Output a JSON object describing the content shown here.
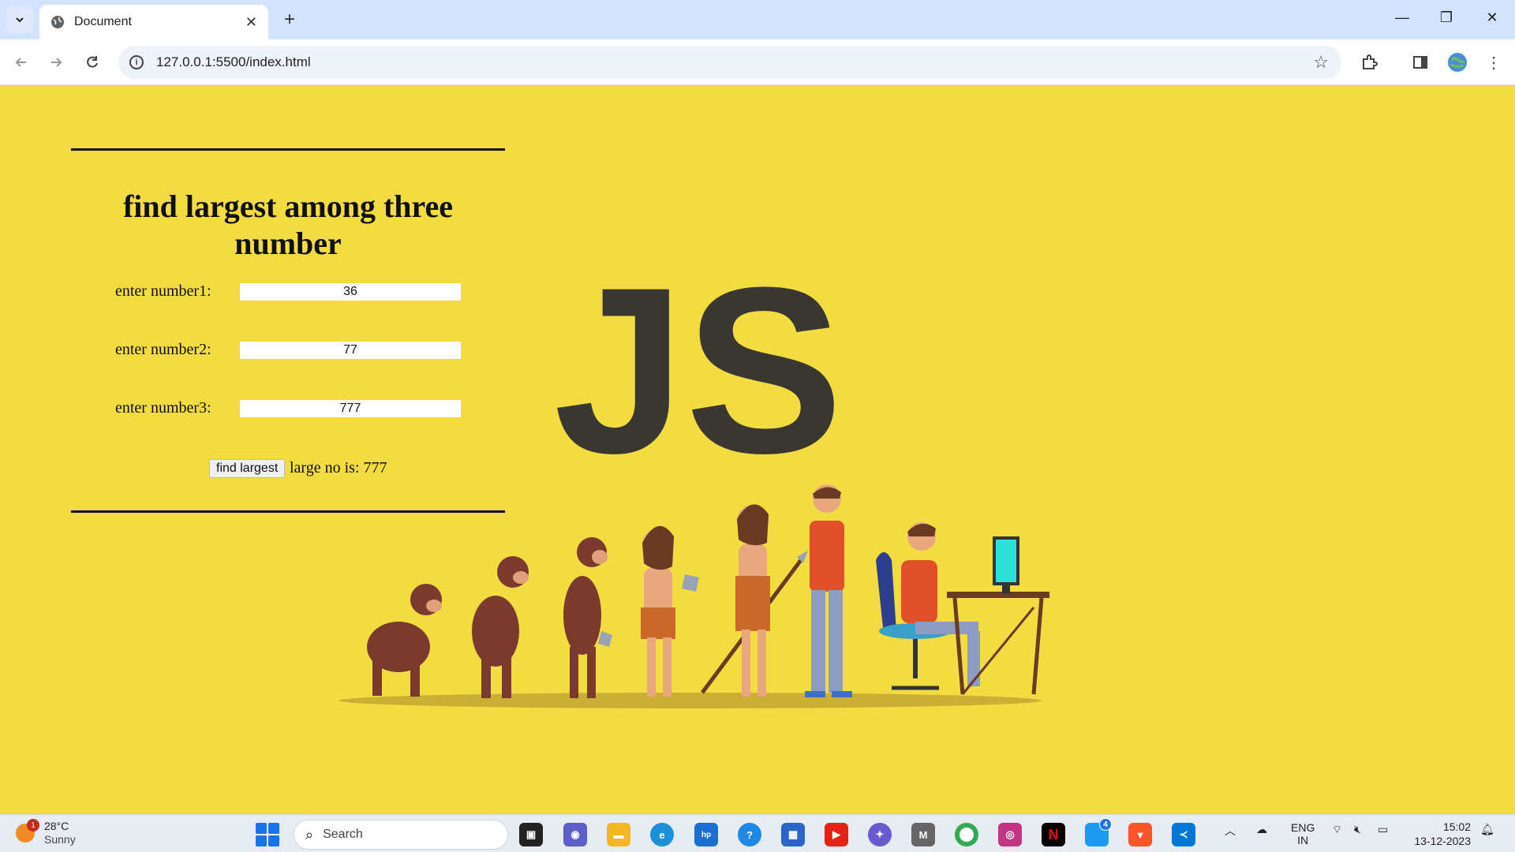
{
  "browser": {
    "tab_title": "Document",
    "url": "127.0.0.1:5500/index.html"
  },
  "page": {
    "heading_line1": "find largest among three",
    "heading_line2": "number",
    "fields": [
      {
        "label": "enter number1:",
        "value": "36"
      },
      {
        "label": "enter number2:",
        "value": "77"
      },
      {
        "label": "enter number3:",
        "value": "777"
      }
    ],
    "button_label": "find largest",
    "result_text": "large no is: 777",
    "logo_text": "JS"
  },
  "taskbar": {
    "weather_temp": "28°C",
    "weather_desc": "Sunny",
    "weather_badge": "1",
    "search_label": "Search",
    "twitter_badge": "4",
    "lang_line1": "ENG",
    "lang_line2": "IN",
    "time": "15:02",
    "date": "13-12-2023"
  },
  "colors": {
    "page_bg": "#f2dc41",
    "logo": "#3a3630",
    "chrome_tabbar": "#d3e3fd"
  }
}
